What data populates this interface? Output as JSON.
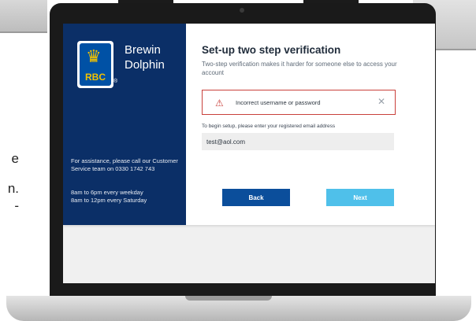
{
  "left_panel": {
    "brand_lines": "Brewin\nDolphin",
    "logo_text": "RBC",
    "logo_reg": "®",
    "assistance": "For assistance, please call our Customer Service team on 0330 1742 743",
    "hours": "8am to 6pm every weekday\n8am to 12pm every Saturday"
  },
  "main": {
    "title": "Set-up two step verification",
    "subtitle": "Two-step verification makes it harder for someone else to access your account",
    "error_message": "Incorrect username or password",
    "setup_label": "To begin setup, please enter your registered email address",
    "email_value": "test@aol.com",
    "back_label": "Back",
    "next_label": "Next"
  },
  "side_text": {
    "line1": "e",
    "line2": "n.",
    "line3": "-"
  },
  "icons": {
    "warning": "warning-icon",
    "close": "close-icon",
    "logo": "lion-crest-icon"
  },
  "colors": {
    "brand_navy": "#0b2f67",
    "error_red": "#c9403b",
    "back_button": "#0b4e9b",
    "next_button": "#4fc0ea"
  }
}
